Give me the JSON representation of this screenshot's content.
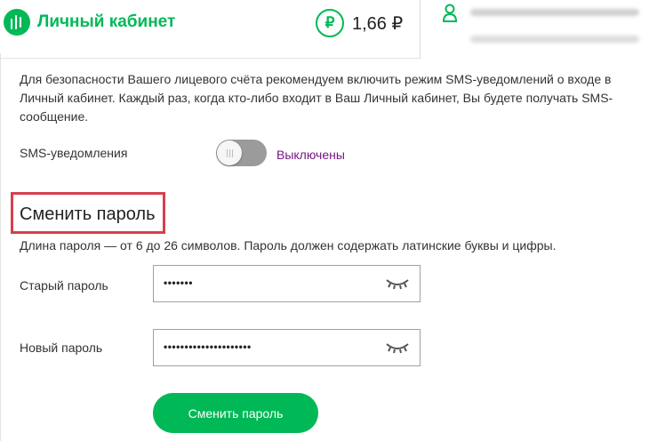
{
  "header": {
    "logo_text": "Личный кабинет",
    "balance_currency": "₽",
    "balance": "1,66 ₽"
  },
  "security": {
    "notice": "Для безопасности Вашего лицевого счёта рекомендуем включить режим SMS-уведомлений о входе в Личный кабинет. Каждый раз, когда кто-либо входит в Ваш Личный кабинет, Вы будете получать SMS-сообщение.",
    "sms_label": "SMS-уведомления",
    "sms_enabled": false,
    "sms_status": "Выключены"
  },
  "password": {
    "title": "Сменить пароль",
    "hint": "Длина пароля — от 6 до 26 символов. Пароль должен содержать латинские буквы и цифры.",
    "old_label": "Старый пароль",
    "old_value": "•••••••",
    "new_label": "Новый пароль",
    "new_value": "•••••••••••••••••••••",
    "submit_label": "Сменить пароль"
  },
  "colors": {
    "brand_green": "#00b956",
    "status_purple": "#731982",
    "highlight_red": "#d6404f"
  },
  "icons": [
    "megafon-logo-icon",
    "ruble-icon",
    "user-icon",
    "eye-closed-icon",
    "eye-closed-icon"
  ]
}
